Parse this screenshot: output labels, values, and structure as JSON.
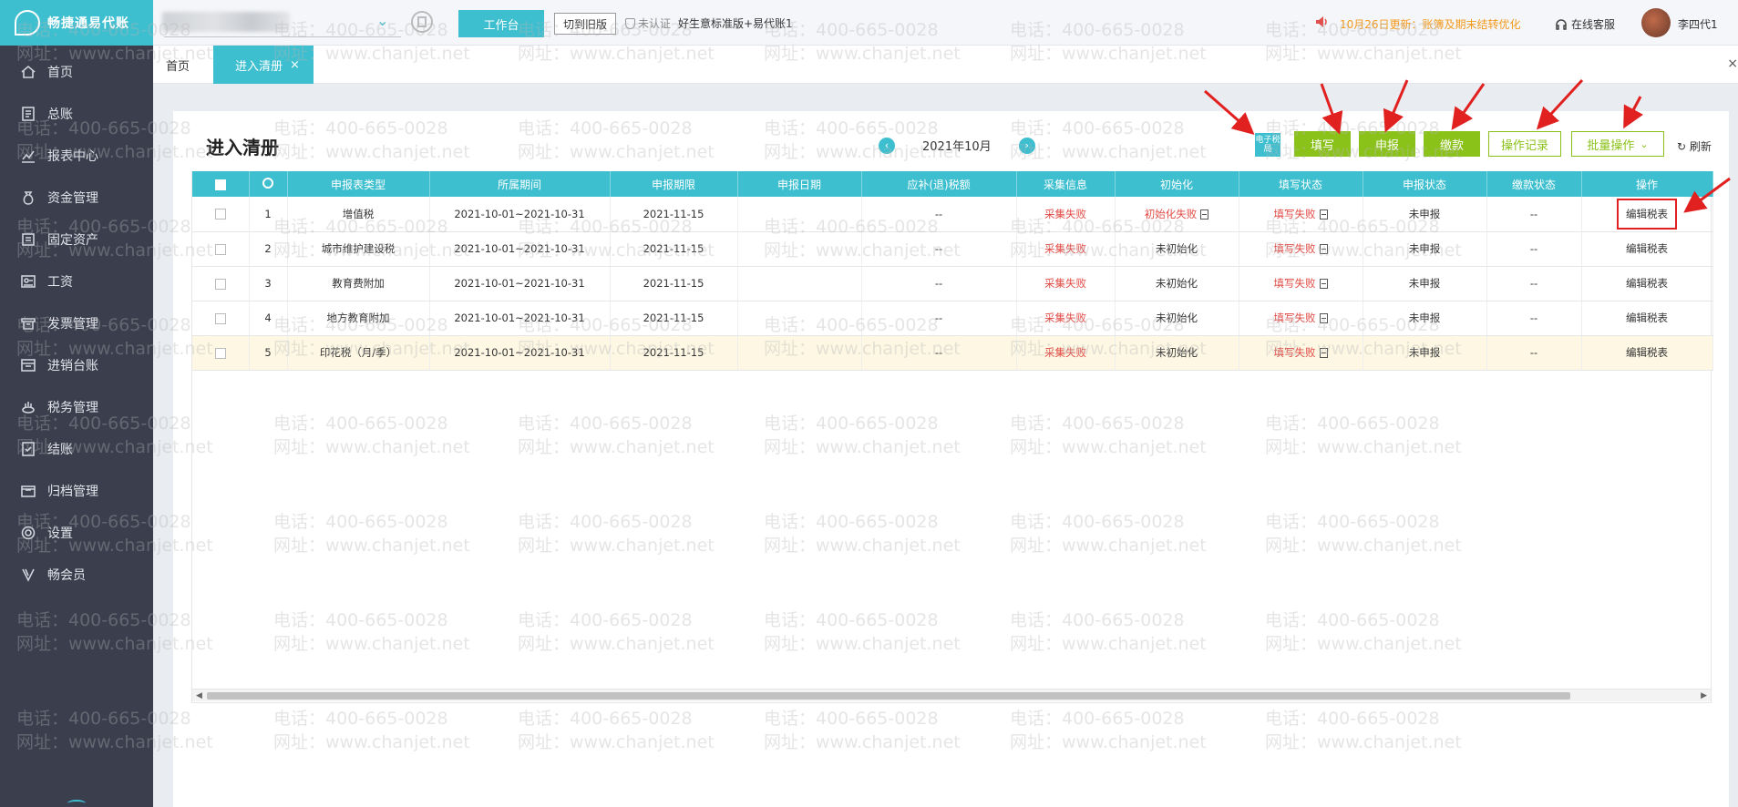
{
  "app": {
    "name": "畅捷通易代账",
    "logo_icon": "swirl-logo-icon"
  },
  "sidebar": {
    "items": [
      {
        "label": "首页",
        "icon": "home-icon"
      },
      {
        "label": "总账",
        "icon": "ledger-icon"
      },
      {
        "label": "报表中心",
        "icon": "chart-icon"
      },
      {
        "label": "资金管理",
        "icon": "money-bag-icon"
      },
      {
        "label": "固定资产",
        "icon": "asset-icon"
      },
      {
        "label": "工资",
        "icon": "salary-icon"
      },
      {
        "label": "发票管理",
        "icon": "invoice-icon"
      },
      {
        "label": "进销台账",
        "icon": "inventory-icon"
      },
      {
        "label": "税务管理",
        "icon": "tax-icon"
      },
      {
        "label": "结账",
        "icon": "checkout-icon"
      },
      {
        "label": "归档管理",
        "icon": "archive-icon"
      },
      {
        "label": "设置",
        "icon": "gear-icon"
      },
      {
        "label": "畅会员",
        "icon": "member-v-icon"
      }
    ]
  },
  "topbar": {
    "workbench_label": "工作台",
    "old_version_label": "切到旧版",
    "verify_label": "未认证",
    "product_label": "好生意标准版+易代账1",
    "notice": "10月26日更新：账簿及期末结转优化",
    "service_label": "在线客服",
    "username": "李四代1"
  },
  "tabs": {
    "home": "首页",
    "active": "进入清册",
    "close": "×"
  },
  "page": {
    "title": "进入清册",
    "month": "2021年10月",
    "etax_label": "电子税局",
    "fill_label": "填写",
    "declare_label": "申报",
    "pay_label": "缴款",
    "oplog_label": "操作记录",
    "batch_label": "批量操作",
    "refresh_label": "刷新"
  },
  "table": {
    "headers": [
      "申报表类型",
      "所属期间",
      "申报期限",
      "申报日期",
      "应补(退)税额",
      "采集信息",
      "初始化",
      "填写状态",
      "申报状态",
      "缴款状态",
      "操作"
    ],
    "rows": [
      {
        "no": "1",
        "type": "增值税",
        "period": "2021-10-01~2021-10-31",
        "deadline": "2021-11-15",
        "date": "",
        "amount": "--",
        "collect": "采集失败",
        "init": "初始化失败",
        "fill": "填写失败",
        "declare": "未申报",
        "pay": "--",
        "op": "编辑税表"
      },
      {
        "no": "2",
        "type": "城市维护建设税",
        "period": "2021-10-01~2021-10-31",
        "deadline": "2021-11-15",
        "date": "",
        "amount": "--",
        "collect": "采集失败",
        "init": "未初始化",
        "fill": "填写失败",
        "declare": "未申报",
        "pay": "--",
        "op": "编辑税表"
      },
      {
        "no": "3",
        "type": "教育费附加",
        "period": "2021-10-01~2021-10-31",
        "deadline": "2021-11-15",
        "date": "",
        "amount": "--",
        "collect": "采集失败",
        "init": "未初始化",
        "fill": "填写失败",
        "declare": "未申报",
        "pay": "--",
        "op": "编辑税表"
      },
      {
        "no": "4",
        "type": "地方教育附加",
        "period": "2021-10-01~2021-10-31",
        "deadline": "2021-11-15",
        "date": "",
        "amount": "--",
        "collect": "采集失败",
        "init": "未初始化",
        "fill": "填写失败",
        "declare": "未申报",
        "pay": "--",
        "op": "编辑税表"
      },
      {
        "no": "5",
        "type": "印花税（月/季）",
        "period": "2021-10-01~2021-10-31",
        "deadline": "2021-11-15",
        "date": "",
        "amount": "--",
        "collect": "采集失败",
        "init": "未初始化",
        "fill": "填写失败",
        "declare": "未申报",
        "pay": "--",
        "op": "编辑税表"
      }
    ]
  },
  "watermark": {
    "phone": "电话：400-665-0028",
    "site": "网址：www.chanjet.net"
  },
  "colors": {
    "accent": "#3ebfcf",
    "green": "#8bc21a",
    "error": "#e14a44",
    "sidebar": "#3a3e4d",
    "notice": "#f39a1d",
    "highlight_row": "#fdf7e3",
    "annotation": "#e12020"
  }
}
